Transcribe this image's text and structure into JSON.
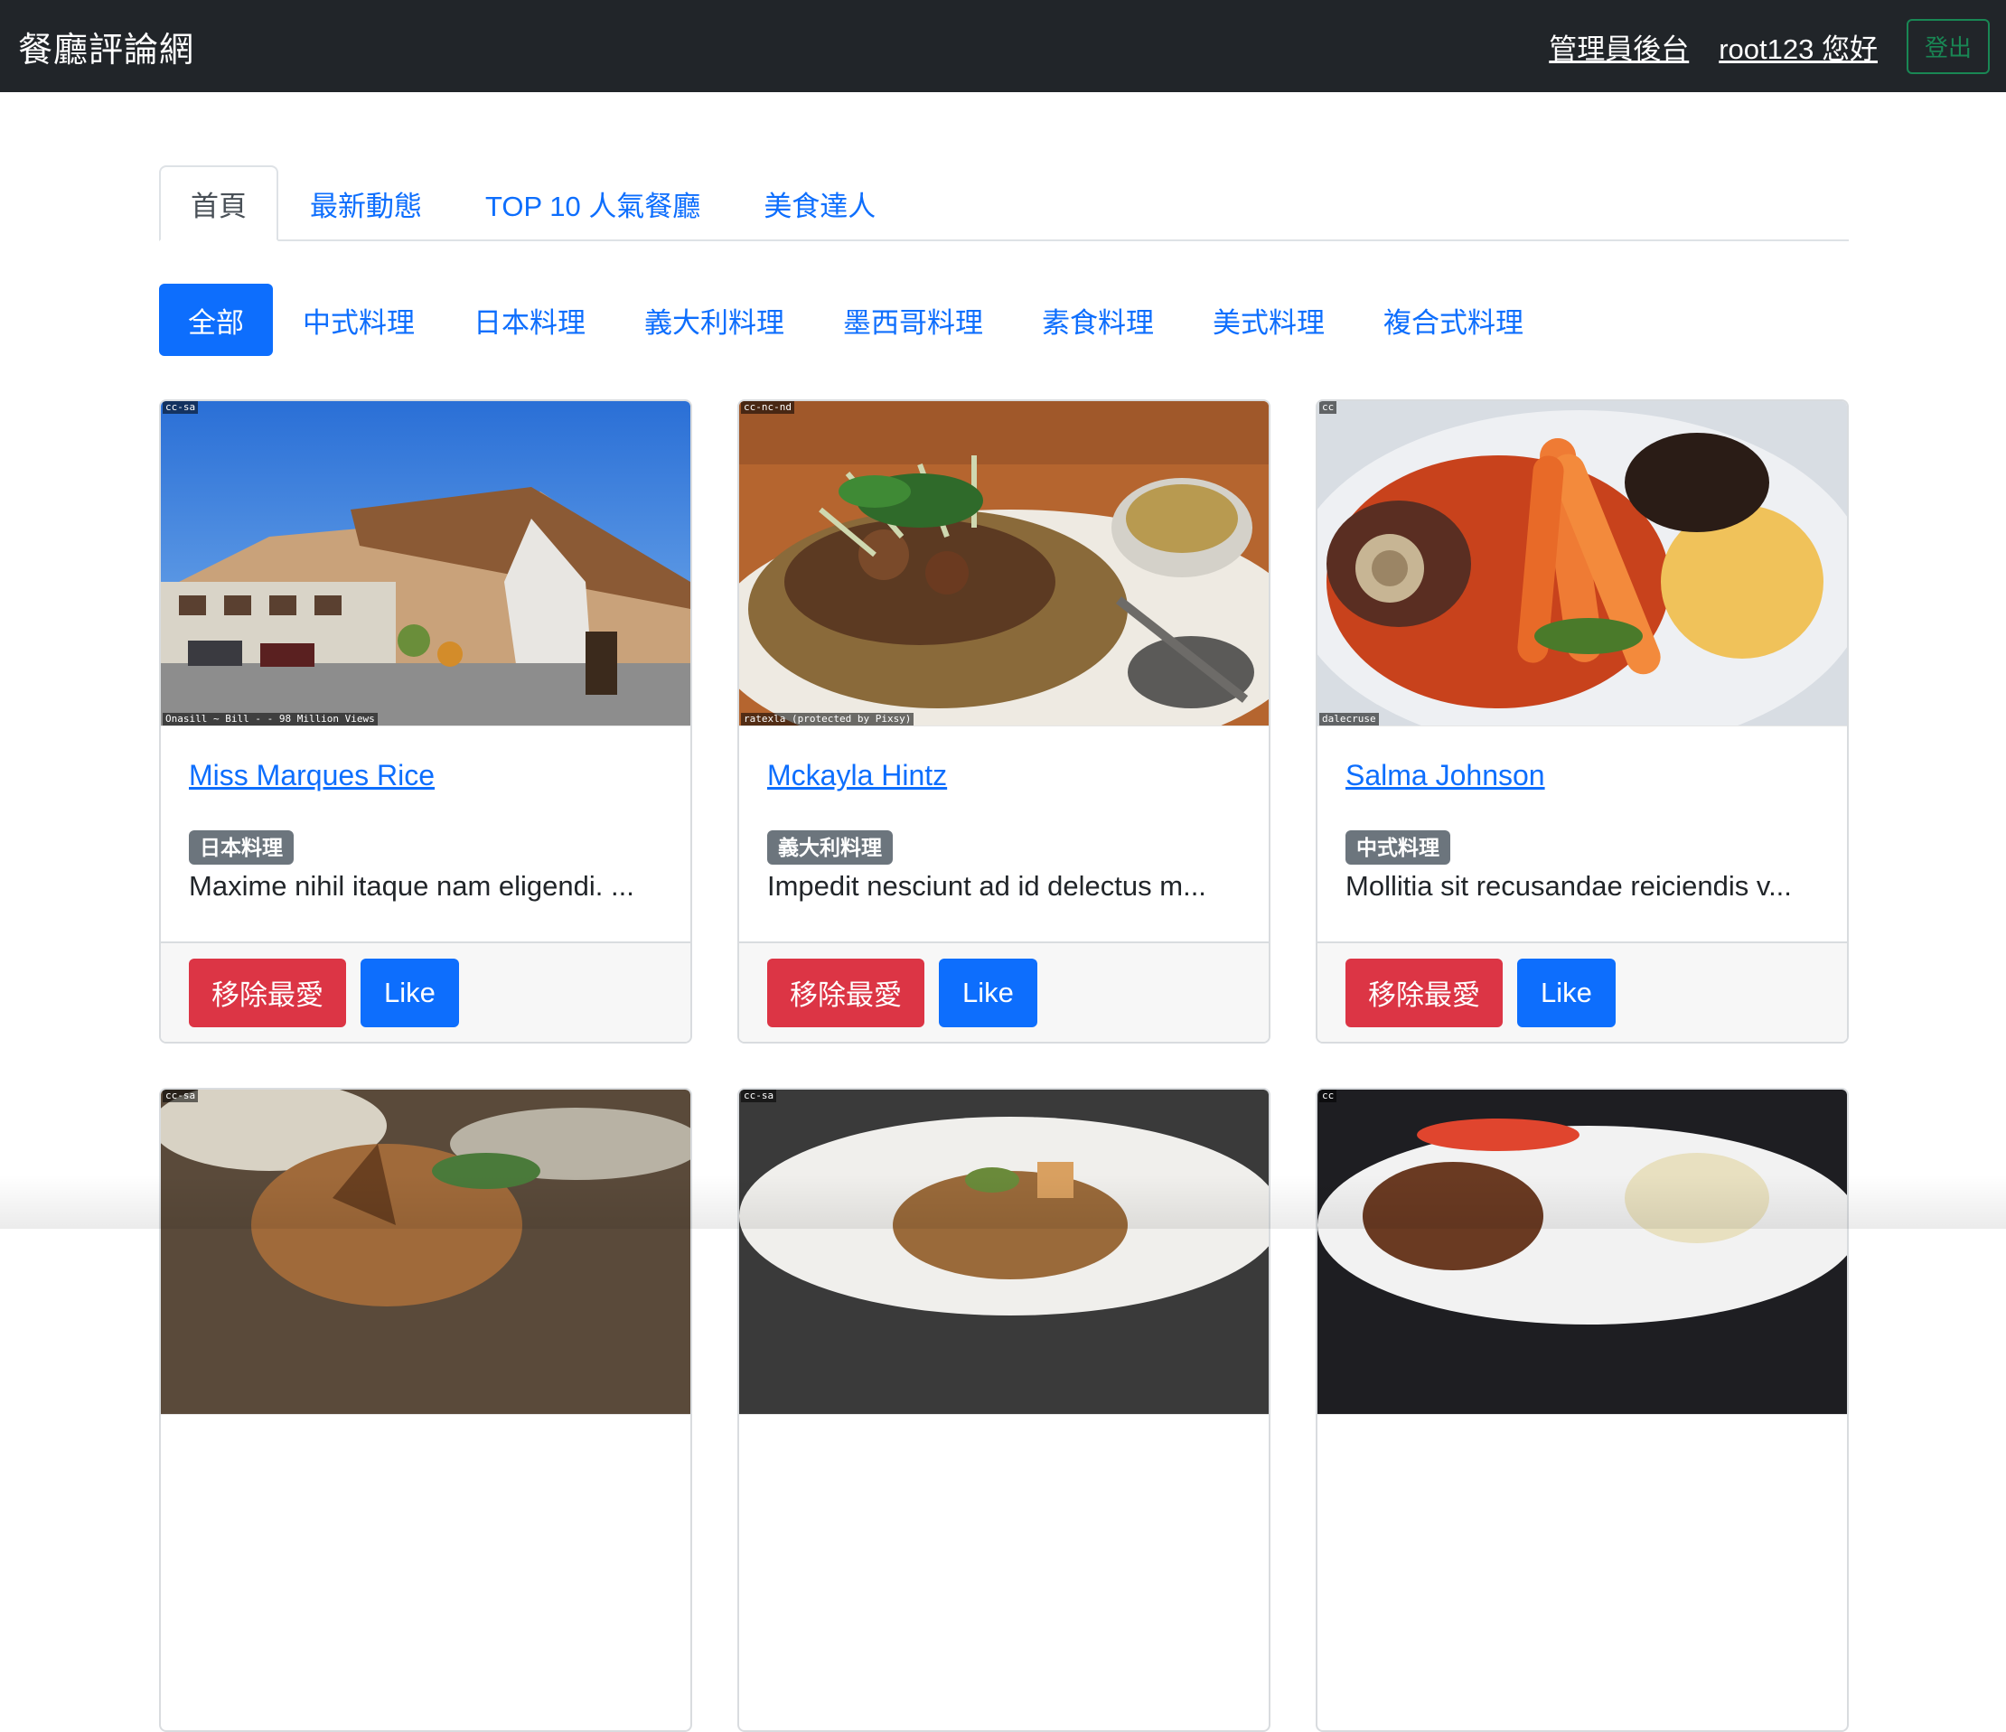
{
  "navbar": {
    "brand": "餐廳評論網",
    "admin_link": "管理員後台",
    "user_greeting": "root123 您好",
    "logout_label": "登出"
  },
  "tabs": [
    {
      "label": "首頁",
      "active": true
    },
    {
      "label": "最新動態",
      "active": false
    },
    {
      "label": "TOP 10 人氣餐廳",
      "active": false
    },
    {
      "label": "美食達人",
      "active": false
    }
  ],
  "categories": [
    {
      "label": "全部",
      "active": true
    },
    {
      "label": "中式料理",
      "active": false
    },
    {
      "label": "日本料理",
      "active": false
    },
    {
      "label": "義大利料理",
      "active": false
    },
    {
      "label": "墨西哥料理",
      "active": false
    },
    {
      "label": "素食料理",
      "active": false
    },
    {
      "label": "美式料理",
      "active": false
    },
    {
      "label": "複合式料理",
      "active": false
    }
  ],
  "restaurants": [
    {
      "name": "Miss Marques Rice",
      "category": "日本料理",
      "description": "Maxime nihil itaque nam eligendi. ...",
      "image_license": "cc-sa",
      "image_credit": "Onasill ~ Bill - - 98 Million Views",
      "remove_label": "移除最愛",
      "like_label": "Like"
    },
    {
      "name": "Mckayla Hintz",
      "category": "義大利料理",
      "description": "Impedit nesciunt ad id delectus m...",
      "image_license": "cc-nc-nd",
      "image_credit": "ratexla (protected by Pixsy)",
      "remove_label": "移除最愛",
      "like_label": "Like"
    },
    {
      "name": "Salma Johnson",
      "category": "中式料理",
      "description": "Mollitia sit recusandae reiciendis v...",
      "image_license": "cc",
      "image_credit": "dalecruse",
      "remove_label": "移除最愛",
      "like_label": "Like"
    },
    {
      "image_license": "cc-sa"
    },
    {
      "image_license": "cc-sa"
    },
    {
      "image_license": "cc"
    }
  ],
  "colors": {
    "navbar_bg": "#212529",
    "primary": "#0d6efd",
    "danger": "#dc3545",
    "success": "#198754",
    "badge": "#6c757d"
  }
}
